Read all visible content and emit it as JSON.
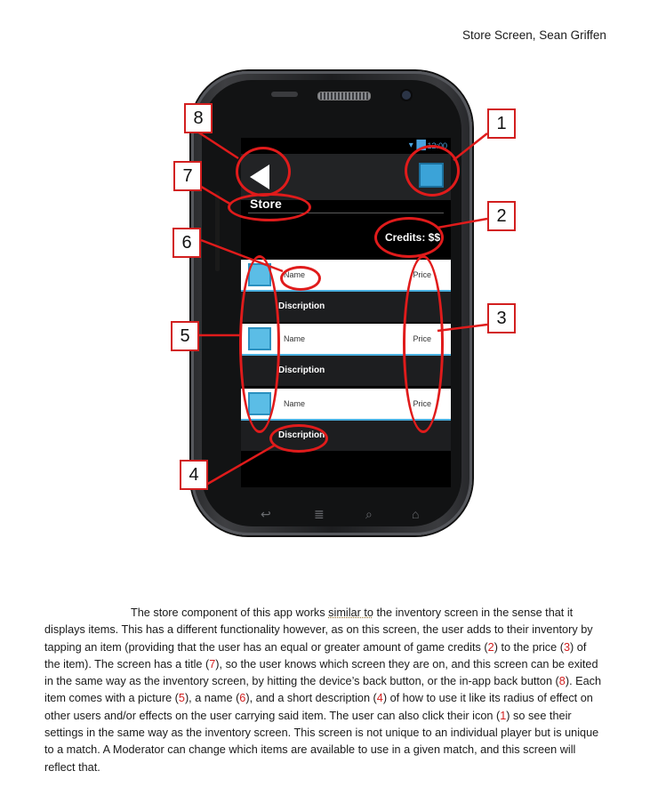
{
  "header": "Store Screen, Sean Griffen",
  "phone": {
    "status_time": "12:00",
    "title": "Store",
    "credits": "Credits: $$",
    "items": [
      {
        "name": "Name",
        "price": "Price",
        "description": "Discription"
      },
      {
        "name": "Name",
        "price": "Price",
        "description": "Discription"
      },
      {
        "name": "Name",
        "price": "Price",
        "description": "Discription"
      }
    ]
  },
  "callouts": [
    "1",
    "2",
    "3",
    "4",
    "5",
    "6",
    "7",
    "8"
  ],
  "paragraph": {
    "s1": "The store component of this app works ",
    "s2": "similar to",
    "s3": " the inventory screen in the sense that it displays items. This has a different functionality however, as on this screen, the user adds to their inventory by tapping an item (providing that the user has an equal or greater amount of game credits (",
    "r1": "2",
    "s4": ") to the price (",
    "r2": "3",
    "s5": ") of the item). The screen has a title (",
    "r3": "7",
    "s6": "), so the user knows which screen they are on, and this screen can be exited in the same way as the inventory screen, by hitting the device’s back button, or the in-app back button (",
    "r4": "8",
    "s7": "). Each item comes with a picture (",
    "r5": "5",
    "s8": "), a name (",
    "r6": "6",
    "s9": "), and a short description (",
    "r7": "4",
    "s10": ") of how to use it like its radius of effect on other users and/or effects on the user carrying said item. The user can also click their icon (",
    "r8": "1",
    "s11": ") so see their settings in the same way as the inventory screen. This screen is not unique to an individual player but is unique to a match. A Moderator can change which items are available to use in a given match, and this screen will reflect that."
  },
  "colors": {
    "annotation": "#e01b1b",
    "accent": "#4ab0e0",
    "screen_bg": "#000000"
  }
}
